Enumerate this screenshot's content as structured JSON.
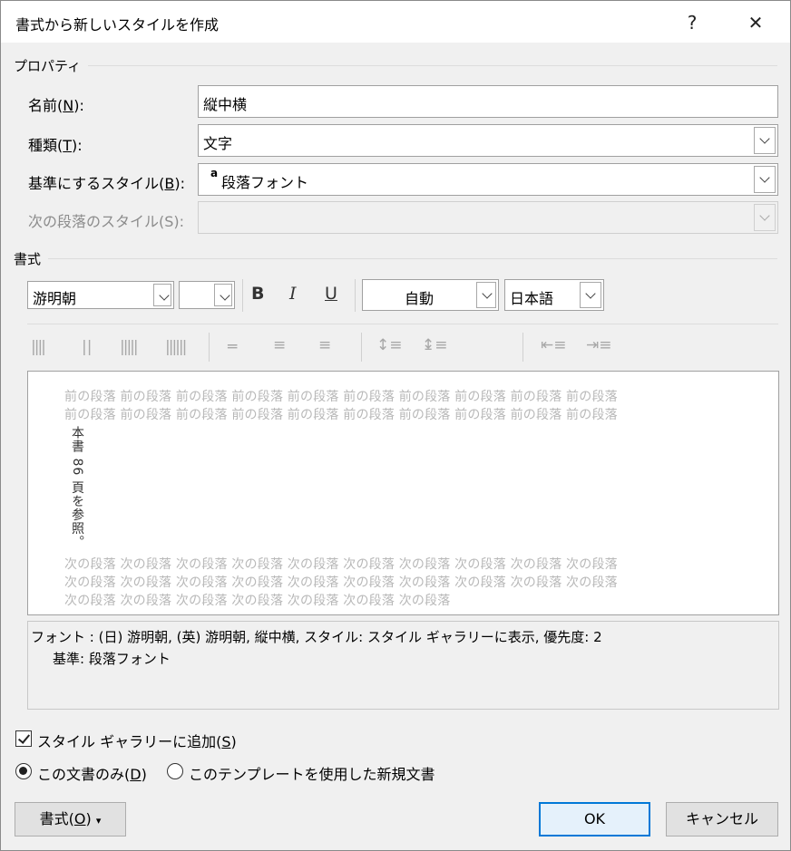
{
  "dialog": {
    "title": "書式から新しいスタイルを作成",
    "help": "?",
    "close": "✕"
  },
  "properties": {
    "section": "プロパティ",
    "name_label": "名前(N):",
    "name_value": "縦中横",
    "type_label": "種類(T):",
    "type_value": "文字",
    "base_label": "基準にするスタイル(B):",
    "base_value": "段落フォント",
    "base_icon": "a",
    "next_label": "次の段落のスタイル(S):",
    "next_value": ""
  },
  "format": {
    "section": "書式",
    "font": "游明朝",
    "size": "",
    "bold": "B",
    "italic": "I",
    "underline": "U",
    "color": "自動",
    "language": "日本語"
  },
  "preview": {
    "prev_lines": [
      "前の段落  前の段落  前の段落  前の段落  前の段落  前の段落  前の段落  前の段落  前の段落  前の段落",
      "前の段落  前の段落  前の段落  前の段落  前の段落  前の段落  前の段落  前の段落  前の段落  前の段落"
    ],
    "vertical_text": "本書 86 頁を参照。",
    "next_lines": [
      "次の段落  次の段落  次の段落  次の段落  次の段落  次の段落  次の段落  次の段落  次の段落  次の段落",
      "次の段落  次の段落  次の段落  次の段落  次の段落  次の段落  次の段落  次の段落  次の段落  次の段落",
      "次の段落  次の段落  次の段落  次の段落  次の段落  次の段落  次の段落"
    ]
  },
  "description": {
    "line1": "フォント : (日) 游明朝, (英) 游明朝, 縦中横, スタイル: スタイル ギャラリーに表示, 優先度: 2",
    "line2": "基準: 段落フォント"
  },
  "options": {
    "add_to_gallery": "スタイル ギャラリーに追加(S)",
    "add_to_gallery_checked": true,
    "only_this_doc": "この文書のみ(D)",
    "new_docs": "このテンプレートを使用した新規文書",
    "selected": "only_this_doc"
  },
  "buttons": {
    "format": "書式(O) ▾",
    "ok": "OK",
    "cancel": "キャンセル"
  }
}
